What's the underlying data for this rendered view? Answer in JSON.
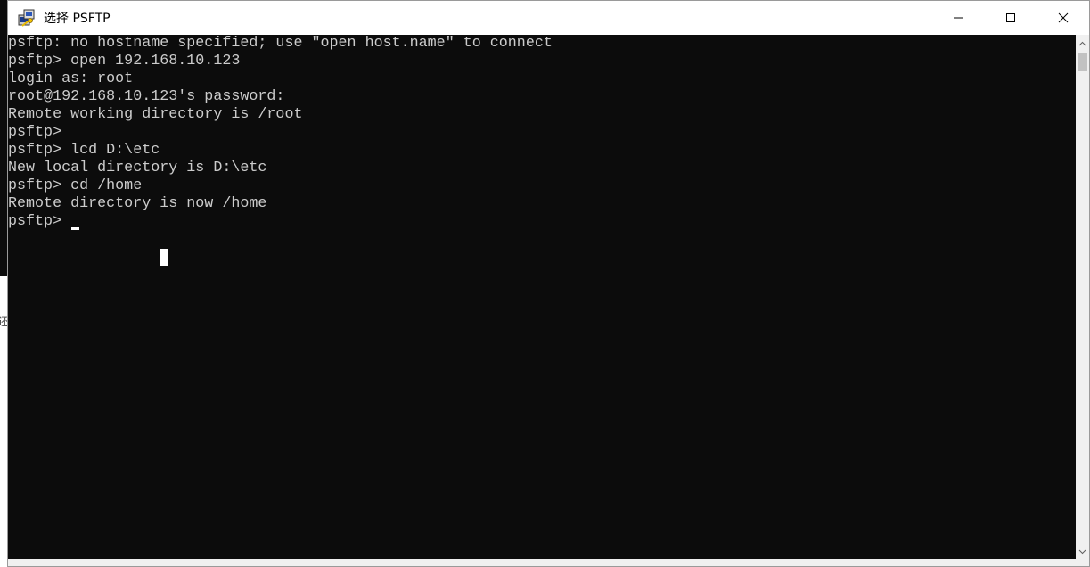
{
  "window": {
    "title": "选择 PSFTP",
    "icon": "putty-icon",
    "controls": {
      "minimize": "minimize-icon",
      "maximize": "maximize-icon",
      "close": "close-icon"
    }
  },
  "console": {
    "lines": [
      "psftp: no hostname specified; use \"open host.name\" to connect",
      "psftp> open 192.168.10.123",
      "login as: root",
      "root@192.168.10.123's password:",
      "Remote working directory is /root",
      "psftp>",
      "psftp> lcd D:\\etc",
      "New local directory is D:\\etc",
      "psftp> cd /home",
      "Remote directory is now /home",
      "psftp> "
    ],
    "colors": {
      "background": "#0c0c0c",
      "text": "#cccccc",
      "cursor": "#ffffff"
    }
  },
  "background_glyph": "还"
}
